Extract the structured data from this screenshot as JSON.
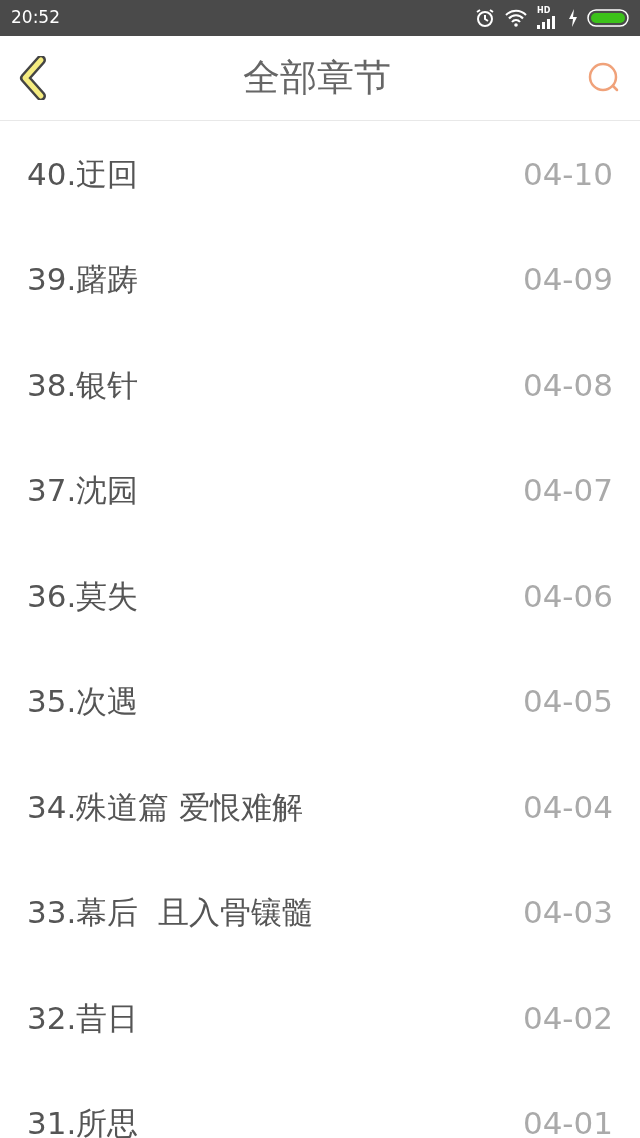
{
  "status_bar": {
    "time": "20:52",
    "network": "HD"
  },
  "header": {
    "title": "全部章节"
  },
  "chapters": [
    {
      "title": "40.迂回",
      "date": "04-10"
    },
    {
      "title": "39.躇踌",
      "date": "04-09"
    },
    {
      "title": "38.银针",
      "date": "04-08"
    },
    {
      "title": "37.沈园",
      "date": "04-07"
    },
    {
      "title": "36.莫失",
      "date": "04-06"
    },
    {
      "title": "35.次遇",
      "date": "04-05"
    },
    {
      "title": "34.殊道篇 爱恨难解",
      "date": "04-04"
    },
    {
      "title": "33.幕后  且入骨镶髓",
      "date": "04-03"
    },
    {
      "title": "32.昔日",
      "date": "04-02"
    },
    {
      "title": "31.所思",
      "date": "04-01"
    }
  ]
}
